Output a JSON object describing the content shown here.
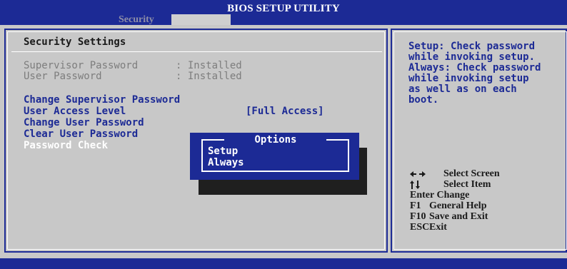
{
  "header": {
    "title": "BIOS SETUP UTILITY",
    "active_tab": "Security"
  },
  "main": {
    "heading": "Security Settings",
    "info_rows": [
      {
        "label": "Supervisor Password",
        "value": ": Installed"
      },
      {
        "label": "User Password",
        "value": ": Installed"
      }
    ],
    "options": {
      "change_supervisor": "Change Supervisor Password",
      "user_access_level": "User Access Level",
      "user_access_value": "[Full Access]",
      "change_user": "Change User Password",
      "clear_user": "Clear User Password",
      "password_check": "Password Check"
    }
  },
  "help": {
    "lines": [
      "Setup: Check password",
      "while invoking setup.",
      "Always: Check password",
      "while invoking setup",
      "as well as on each",
      "boot."
    ]
  },
  "keys": {
    "select_screen": "Select Screen",
    "select_item": "Select Item",
    "enter_change": "Enter Change",
    "f1_key": "F1",
    "f1_label": "General Help",
    "f10_key": "F10",
    "f10_label": "Save and Exit",
    "esc_key": "ESC",
    "esc_label": "Exit"
  },
  "popup": {
    "title": "Options",
    "items": [
      "Setup",
      "Always"
    ]
  },
  "colors": {
    "bios_blue": "#1c2a95",
    "background_gray": "#c8c8c8",
    "shadow": "#1f1f1f"
  },
  "icons": {
    "left_right": "left-right-arrows-icon",
    "up_down": "up-down-arrows-icon"
  }
}
